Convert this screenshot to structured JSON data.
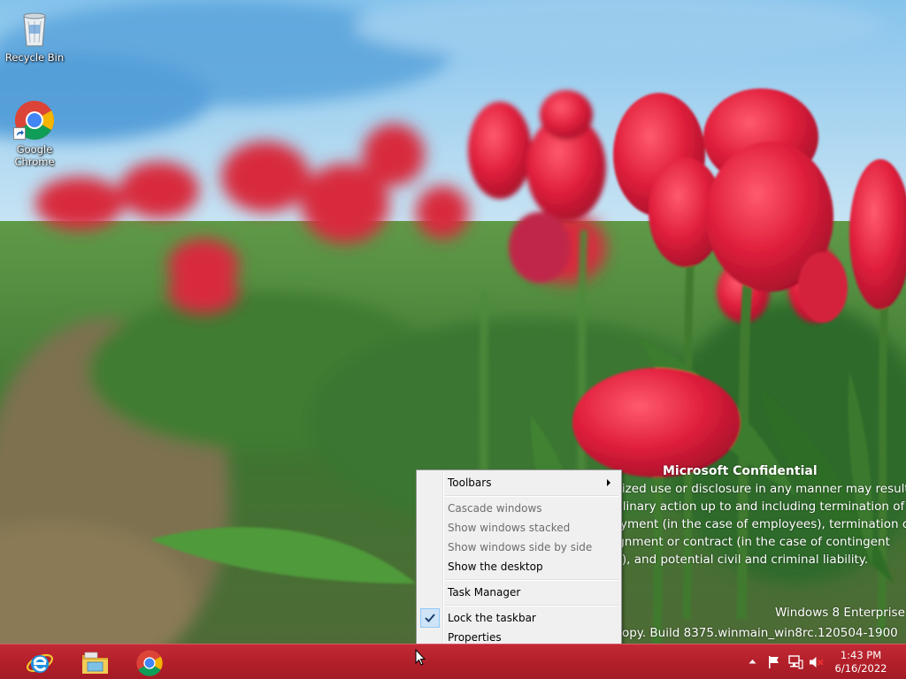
{
  "desktop": {
    "icons": [
      {
        "label": "Recycle Bin",
        "icon": "recycle-bin-icon"
      },
      {
        "label": "Google Chrome",
        "icon": "chrome-icon"
      }
    ]
  },
  "watermark": {
    "title": "Microsoft Confidential",
    "lines": [
      "Unauthorized use or disclosure in any manner may result",
      "in disciplinary action up to and including termination of",
      "employment (in the case of employees), termination of",
      "an assignment or contract (in the case of contingent",
      "staff), and potential civil and criminal liability."
    ],
    "edition": "Windows 8 Enterprise",
    "build": "Evaluation copy. Build 8375.winmain_win8rc.120504-1900"
  },
  "context_menu": {
    "items": [
      {
        "label": "Toolbars",
        "disabled": false,
        "submenu": true
      },
      {
        "label": "Cascade windows",
        "disabled": true
      },
      {
        "label": "Show windows stacked",
        "disabled": true
      },
      {
        "label": "Show windows side by side",
        "disabled": true
      },
      {
        "label": "Show the desktop",
        "disabled": false
      },
      {
        "label": "Task Manager",
        "disabled": false
      },
      {
        "label": "Lock the taskbar",
        "disabled": false,
        "checked": true
      },
      {
        "label": "Properties",
        "disabled": false
      }
    ]
  },
  "taskbar": {
    "pinned": [
      {
        "app": "Internet Explorer",
        "icon": "internet-explorer-icon"
      },
      {
        "app": "File Explorer",
        "icon": "file-explorer-icon"
      },
      {
        "app": "Google Chrome",
        "icon": "chrome-icon"
      }
    ],
    "tray_icons": [
      "show-hidden-icons-chevron-icon",
      "action-center-flag-icon",
      "network-icon",
      "volume-muted-icon"
    ],
    "clock": {
      "time": "1:43 PM",
      "date": "6/16/2022"
    },
    "color": "#b3202a"
  }
}
